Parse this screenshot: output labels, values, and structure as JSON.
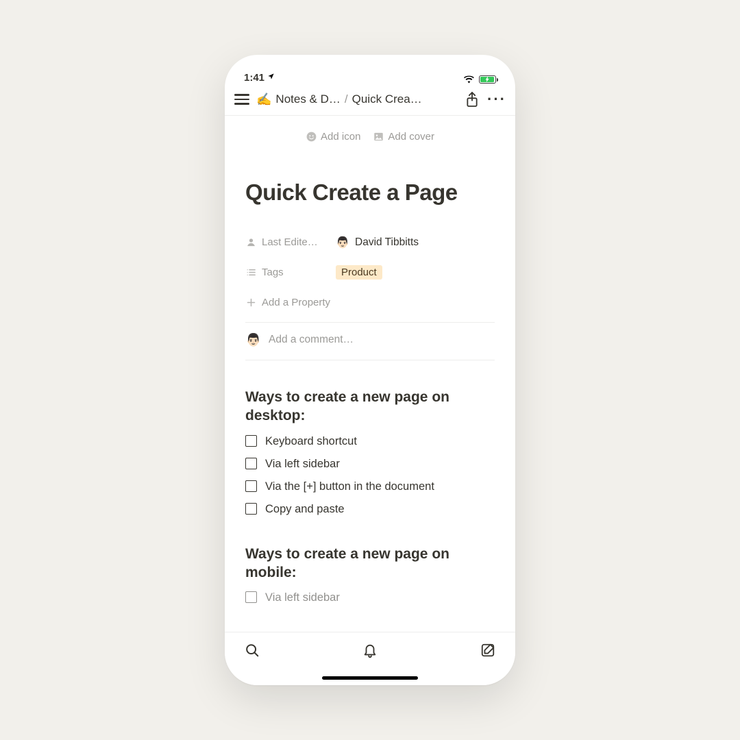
{
  "status": {
    "time": "1:41"
  },
  "nav": {
    "breadcrumb_parent": "Notes & D…",
    "breadcrumb_current": "Quick Crea…",
    "breadcrumb_separator": "/",
    "page_emoji": "✍️"
  },
  "cover": {
    "add_icon_label": "Add icon",
    "add_cover_label": "Add cover"
  },
  "page": {
    "title": "Quick Create a Page"
  },
  "properties": {
    "last_edited": {
      "label": "Last Edite…",
      "value": "David Tibbitts"
    },
    "tags": {
      "label": "Tags",
      "value": "Product"
    },
    "add_property_label": "Add a Property"
  },
  "comments": {
    "placeholder": "Add a comment…"
  },
  "sections": [
    {
      "heading": "Ways to create a new page on desktop:",
      "items": [
        "Keyboard shortcut",
        "Via left sidebar",
        "Via the [+] button in the document",
        "Copy and paste"
      ]
    },
    {
      "heading": "Ways to create a new page on mobile:",
      "items": [
        "Via left sidebar"
      ]
    }
  ]
}
